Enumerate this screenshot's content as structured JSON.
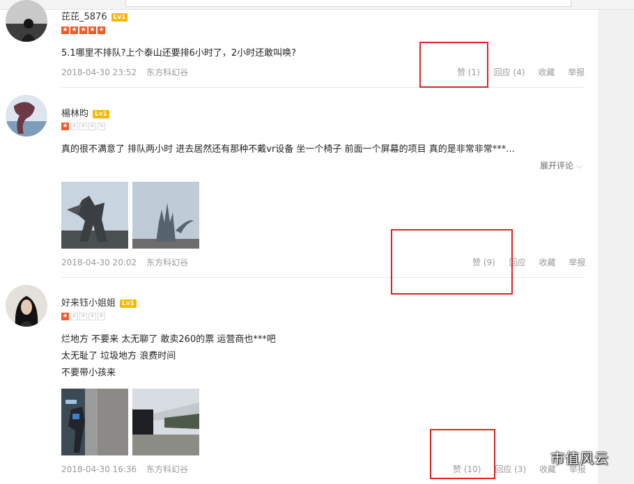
{
  "reviews": [
    {
      "username": "芘芘_5876",
      "level": "Lv1",
      "rating": 5,
      "content_lines": [
        "5.1哪里不排队?上个泰山还要排6小时了，2小时还敢叫唤?"
      ],
      "date": "2018-04-30 23:52",
      "place": "东方科幻谷",
      "like_label": "赞",
      "like_count": "(1)",
      "reply_label": "回应",
      "reply_count": "(4)",
      "favorite_label": "收藏",
      "report_label": "举报"
    },
    {
      "username": "楊林昀",
      "level": "Lv1",
      "rating": 1,
      "content_lines": [
        "真的很不满意了 排队两小时 进去居然还有那种不戴vr设备 坐一个椅子 前面一个屏幕的项目 真的是非常非常***..."
      ],
      "expand_label": "展开评论",
      "date": "2018-04-30 20:02",
      "place": "东方科幻谷",
      "like_label": "赞",
      "like_count": "(9)",
      "reply_label": "回应",
      "reply_count": "",
      "favorite_label": "收藏",
      "report_label": "举报"
    },
    {
      "username": "好来钰小姐姐",
      "level": "Lv1",
      "rating": 1,
      "content_lines": [
        "烂地方 不要来 太无聊了 敢卖260的票 运营商也***吧",
        "太无耻了 垃圾地方 浪费时间",
        "不要带小孩来"
      ],
      "date": "2018-04-30 16:36",
      "place": "东方科幻谷",
      "like_label": "赞",
      "like_count": "(10)",
      "reply_label": "回应",
      "reply_count": "(3)",
      "favorite_label": "收藏",
      "report_label": "举报"
    }
  ],
  "watermark": {
    "text": "市值风云"
  },
  "colors": {
    "star_on": "#f05a2a",
    "level_badge": "#f5b800",
    "highlight_box": "#e02020",
    "meta_text": "#999999"
  }
}
